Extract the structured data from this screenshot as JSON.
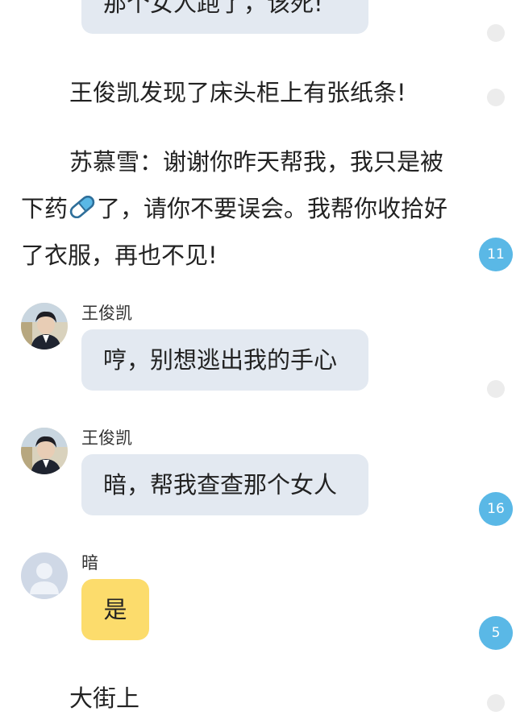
{
  "messages": {
    "top_bubble_text": "那个女人跑了，该死!",
    "msg1": {
      "sender": "王俊凯",
      "text": "哼，别想逃出我的手心"
    },
    "msg2": {
      "sender": "王俊凯",
      "text": "暗，帮我查查那个女人"
    },
    "msg3": {
      "sender": "暗",
      "text": "是"
    }
  },
  "narration": {
    "note_found": "王俊凯发现了床头柜上有张纸条!",
    "letter_line1": "苏慕雪：谢谢你昨天帮我，我只是被",
    "letter_line2_before_icon": "下药",
    "letter_line2_after_icon": "了，请你不要误会。我帮你收拾好",
    "letter_line3": "了衣服，再也不见!",
    "street": "大街上"
  },
  "comment_badges": {
    "badge1": "11",
    "badge2": "16",
    "badge3": "5"
  },
  "icons": {
    "pill": "pill-icon",
    "avatar_user": "avatar-photo",
    "avatar_default": "default-avatar-icon"
  },
  "colors": {
    "bubble_gray": "#e3e9f1",
    "bubble_yellow": "#fcdc6c",
    "badge_blue": "#5ab8e6",
    "dot_gray": "#ececec"
  }
}
